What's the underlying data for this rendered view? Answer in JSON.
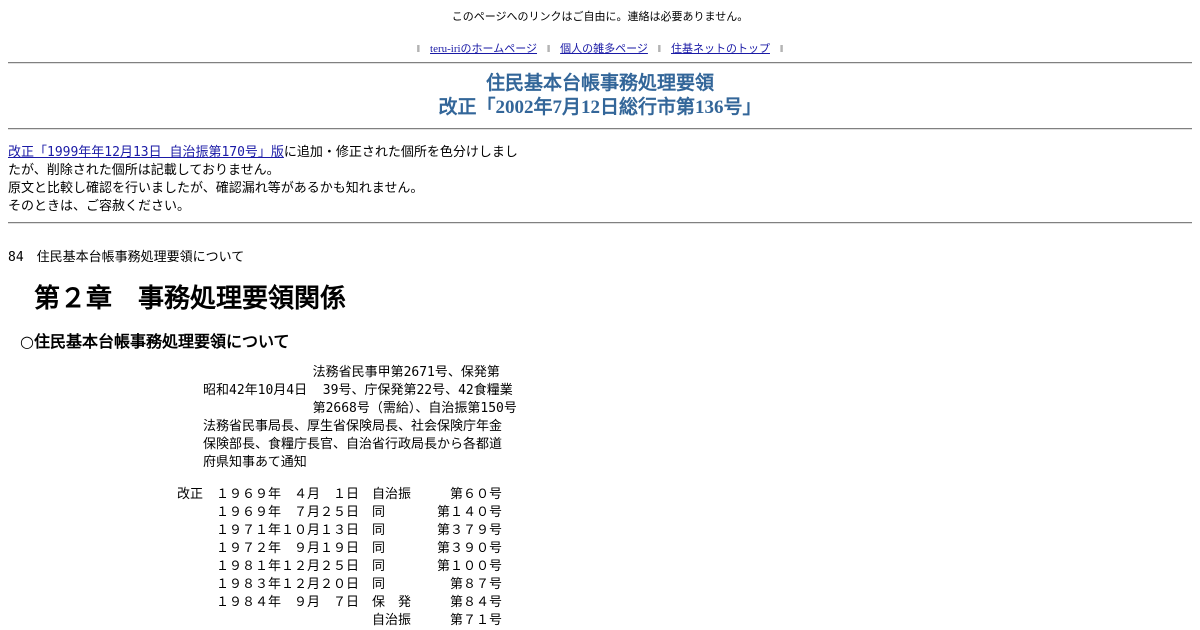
{
  "header": {
    "notice": "このページへのリンクはご自由に。連絡は必要ありません。",
    "nav_bar_mark": "‖",
    "nav": [
      "teru-iriのホームページ",
      "個人の雑多ページ",
      "住基ネットのトップ"
    ]
  },
  "title": {
    "line1": "住民基本台帳事務処理要領",
    "line2": "改正「2002年7月12日総行市第136号」"
  },
  "intro": {
    "link_text": "改正「1999年年12月13日 自治振第170号」版",
    "line1_rest": "に追加・修正された個所を色分けしまし",
    "line2": "たが、削除された個所は記載しておりません。",
    "line3": "原文と比較し確認を行いましたが、確認漏れ等があるかも知れません。",
    "line4": "そのときは、ご容赦ください。"
  },
  "page_number_line": "84　住民基本台帳事務処理要領について",
  "chapter_heading": "第２章　事務処理要領関係",
  "section_heading": "○住民基本台帳事務処理要領について",
  "issuer_block": [
    "              法務省民事甲第2671号、保発第",
    "昭和42年10月4日  39号、庁保発第22号、42食糧業",
    "              第2668号（需給）、自治振第150号",
    "法務省民事局長、厚生省保険局長、社会保険庁年金",
    "保険部長、食糧庁長官、自治省行政局長から各都道",
    "府県知事あて通知"
  ],
  "revisions": [
    "改正　１９６９年　４月　１日　自治振　　　第６０号",
    "　　　１９６９年　７月２５日　同　　　　第１４０号",
    "　　　１９７１年１０月１３日　同　　　　第３７９号",
    "　　　１９７２年　９月１９日　同　　　　第３９０号",
    "　　　１９８１年１２月２５日　同　　　　第１００号",
    "　　　１９８３年１２月２０日　同　　　　　第８７号",
    "　　　１９８４年　９月　７日　保　発　　　第８４号",
    "　　　　　　　　　　　　　　　自治振　　　第７１号"
  ]
}
